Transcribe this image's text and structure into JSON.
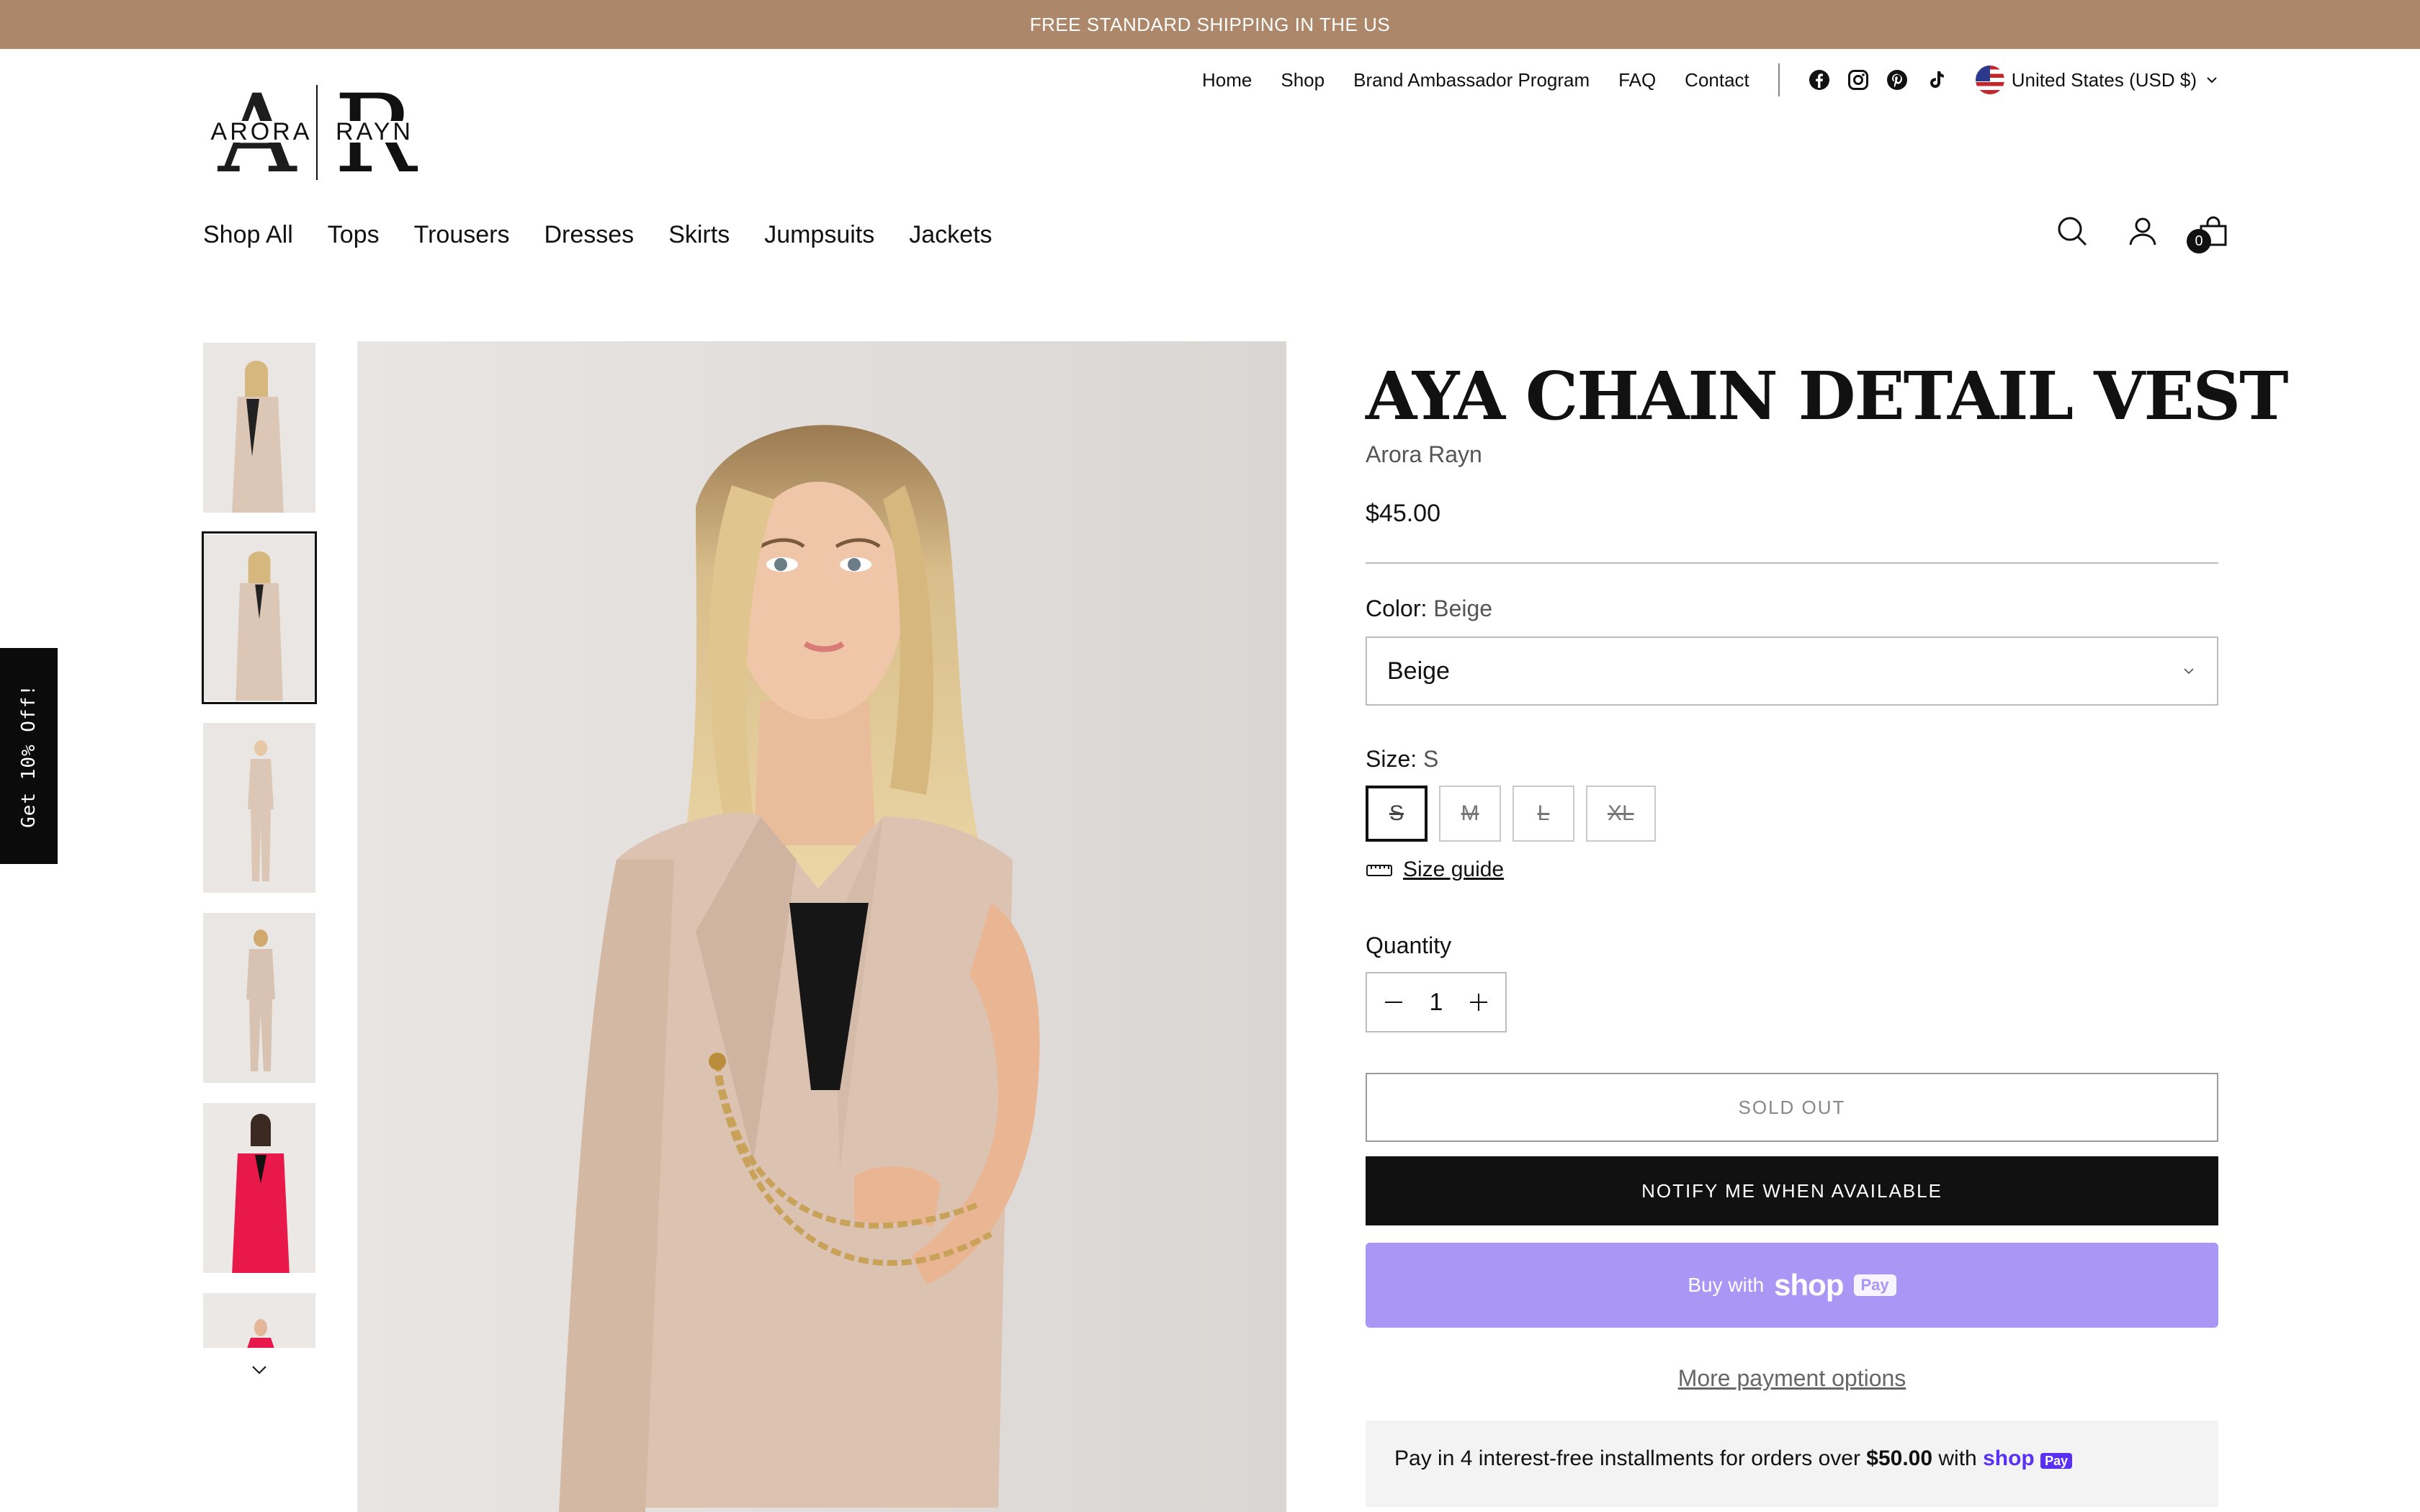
{
  "announcement": "FREE STANDARD SHIPPING IN THE US",
  "utility_nav": {
    "links": [
      "Home",
      "Shop",
      "Brand Ambassador Program",
      "FAQ",
      "Contact"
    ],
    "social_icons": [
      "facebook-icon",
      "instagram-icon",
      "pinterest-icon",
      "tiktok-icon"
    ],
    "country": "United States (USD $)"
  },
  "brand": {
    "left": "ARORA",
    "right": "RAYN"
  },
  "main_nav": [
    "Shop All",
    "Tops",
    "Trousers",
    "Dresses",
    "Skirts",
    "Jumpsuits",
    "Jackets"
  ],
  "header_icons": {
    "search": "search-icon",
    "account": "account-icon",
    "cart": "bag-icon",
    "cart_count": "0"
  },
  "side_tab": "Get 10% Off!",
  "product": {
    "title": "AYA CHAIN DETAIL VEST",
    "vendor": "Arora Rayn",
    "price": "$45.00",
    "color_label": "Color:",
    "color_value": "Beige",
    "color_select_value": "Beige",
    "size_label": "Size:",
    "size_value": "S",
    "sizes": [
      "S",
      "M",
      "L",
      "XL"
    ],
    "size_guide": "Size guide",
    "quantity_label": "Quantity",
    "quantity": "1",
    "sold_out": "SOLD OUT",
    "notify": "NOTIFY ME WHEN AVAILABLE",
    "buy_with": "Buy with",
    "shop_word": "shop",
    "pay_word": "Pay",
    "more_payment": "More payment options",
    "installments": {
      "prefix": "Pay in 4 interest-free installments for orders over ",
      "amount": "$50.00",
      "suffix": " with ",
      "shop": "shop",
      "pay": "Pay"
    }
  },
  "colors": {
    "announcement_bg": "#ad8769",
    "shop_pay_bg": "#a996f5",
    "notify_bg": "#111111"
  }
}
